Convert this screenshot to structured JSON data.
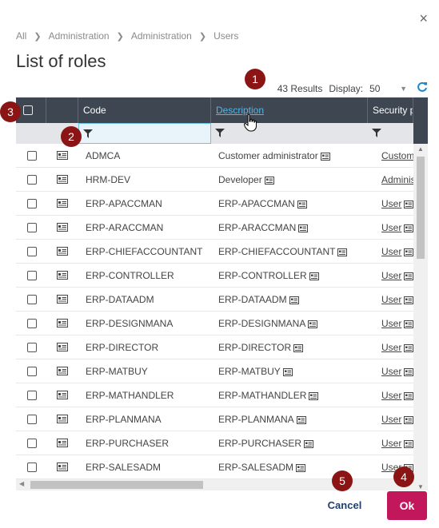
{
  "window": {
    "close_label": "×"
  },
  "breadcrumb": [
    "All",
    "Administration",
    "Administration",
    "Users"
  ],
  "page_title": "List of roles",
  "toolbar": {
    "results": "43 Results",
    "display_label": "Display:",
    "display_value": "50"
  },
  "columns": [
    "Code",
    "Description",
    "Security p"
  ],
  "rows": [
    {
      "code": "ADMCA",
      "description": "Customer administrator",
      "security": "Custom"
    },
    {
      "code": "HRM-DEV",
      "description": "Developer",
      "security": "Adminis"
    },
    {
      "code": "ERP-APACCMAN",
      "description": "ERP-APACCMAN",
      "security": "User"
    },
    {
      "code": "ERP-ARACCMAN",
      "description": "ERP-ARACCMAN",
      "security": "User"
    },
    {
      "code": "ERP-CHIEFACCOUNTANT",
      "description": "ERP-CHIEFACCOUNTANT",
      "security": "User"
    },
    {
      "code": "ERP-CONTROLLER",
      "description": "ERP-CONTROLLER",
      "security": "User"
    },
    {
      "code": "ERP-DATAADM",
      "description": "ERP-DATAADM",
      "security": "User"
    },
    {
      "code": "ERP-DESIGNMANA",
      "description": "ERP-DESIGNMANA",
      "security": "User"
    },
    {
      "code": "ERP-DIRECTOR",
      "description": "ERP-DIRECTOR",
      "security": "User"
    },
    {
      "code": "ERP-MATBUY",
      "description": "ERP-MATBUY",
      "security": "User"
    },
    {
      "code": "ERP-MATHANDLER",
      "description": "ERP-MATHANDLER",
      "security": "User"
    },
    {
      "code": "ERP-PLANMANA",
      "description": "ERP-PLANMANA",
      "security": "User"
    },
    {
      "code": "ERP-PURCHASER",
      "description": "ERP-PURCHASER",
      "security": "User"
    },
    {
      "code": "ERP-SALESADM",
      "description": "ERP-SALESADM",
      "security": "User"
    }
  ],
  "buttons": {
    "cancel": "Cancel",
    "ok": "Ok"
  },
  "callouts": [
    "1",
    "2",
    "3",
    "4",
    "5"
  ],
  "colors": {
    "header_bg": "#3e4651",
    "accent_link": "#55b4e6",
    "ok_button": "#c2185b",
    "cancel_text": "#1f3f6e",
    "callout": "#8b1414",
    "refresh": "#1e88c9"
  },
  "icons": [
    "close-icon",
    "chevron-right-icon",
    "chevron-down-icon",
    "refresh-icon",
    "filter-icon",
    "detail-card-icon",
    "checkbox-icon",
    "cursor-icon"
  ]
}
